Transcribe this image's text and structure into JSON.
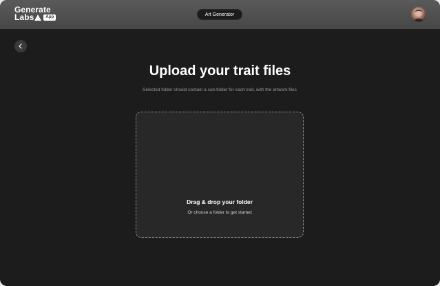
{
  "header": {
    "logo_line1": "Generate",
    "logo_line2": "Labs",
    "logo_badge": "App",
    "tab_label": "Art Generator"
  },
  "icons": {
    "back": "chevron-left-icon",
    "avatar": "user-avatar"
  },
  "main": {
    "title": "Upload your trait files",
    "subtitle": "Selected folder should contain a sub-folder for each trait, with the artwork files",
    "dropzone": {
      "title": "Drag & drop your folder",
      "subtitle": "Or choose a folder to get started"
    }
  },
  "colors": {
    "background": "#1c1c1c",
    "header": "#4e4e4e",
    "dropzone": "#282828",
    "text": "#ffffff"
  }
}
